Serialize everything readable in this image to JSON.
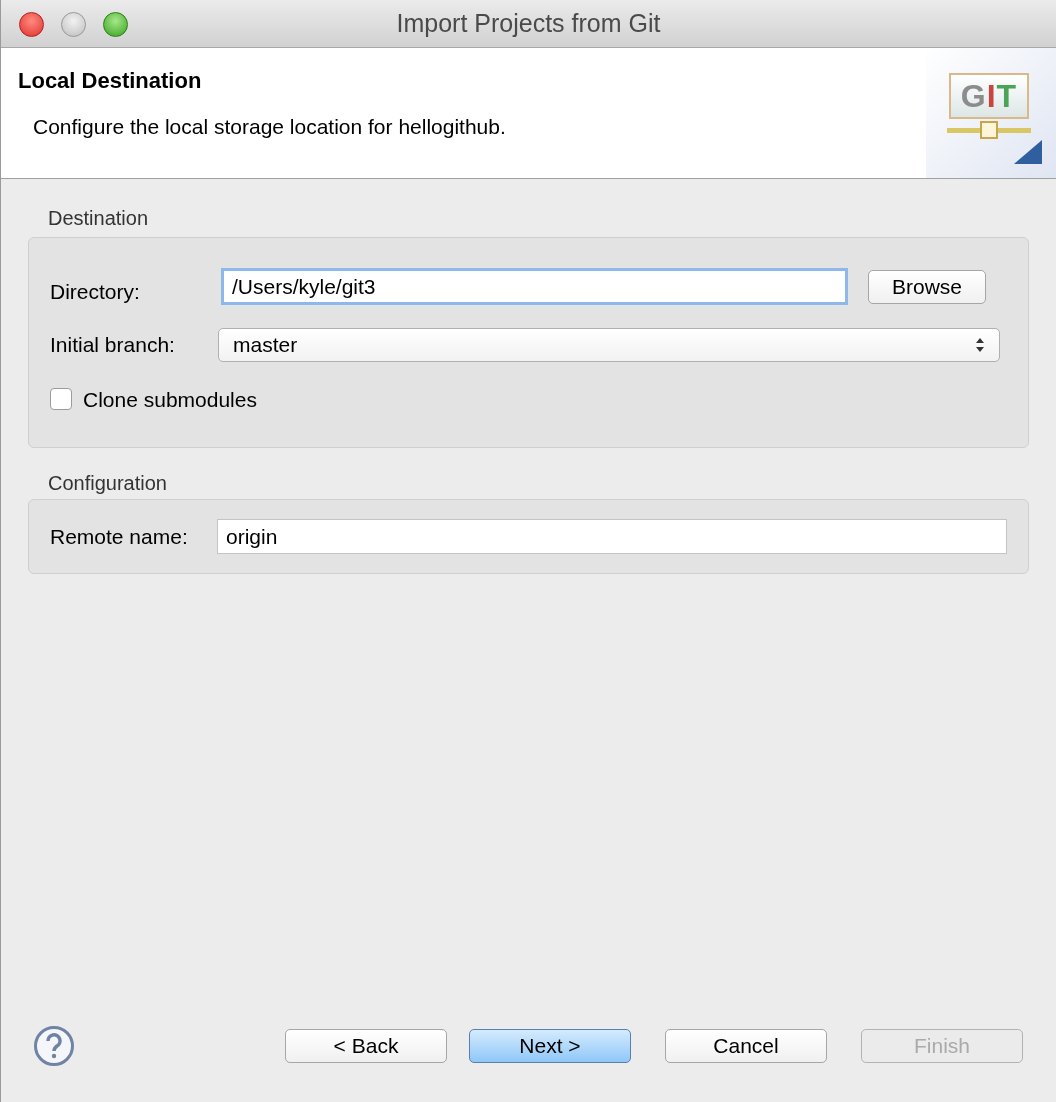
{
  "window": {
    "title": "Import Projects from Git"
  },
  "header": {
    "title": "Local Destination",
    "description": "Configure the local storage location for hellogithub.",
    "logo_text": "GIT"
  },
  "destination": {
    "label": "Destination",
    "directory": {
      "label": "Directory:",
      "value": "/Users/kyle/git3",
      "focused": true,
      "button": "Browse"
    },
    "initial_branch": {
      "label": "Initial branch:",
      "value": "master"
    },
    "clone_submodules": {
      "label": "Clone submodules",
      "checked": false
    }
  },
  "configuration": {
    "label": "Configuration",
    "remote_name": {
      "label": "Remote name:",
      "value": "origin"
    }
  },
  "buttons": [
    {
      "label": "< Back",
      "default": false,
      "disabled": false
    },
    {
      "label": "Next >",
      "default": true,
      "disabled": false
    },
    {
      "label": "Cancel",
      "default": false,
      "disabled": false
    },
    {
      "label": "Finish",
      "default": false,
      "disabled": true
    }
  ]
}
